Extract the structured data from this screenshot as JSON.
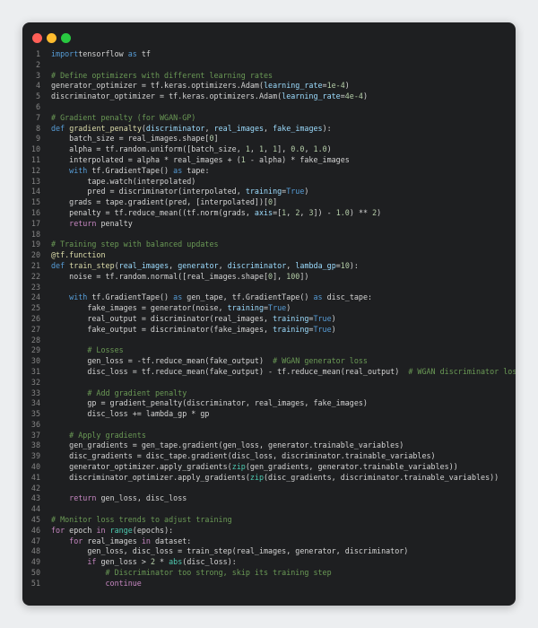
{
  "window": {
    "buttons": [
      "close",
      "minimize",
      "maximize"
    ]
  },
  "code": {
    "lines": [
      {
        "n": "1",
        "segs": [
          [
            "kw",
            "import"
          ],
          [
            "",
            "tensorflow "
          ],
          [
            "kw",
            "as"
          ],
          [
            "",
            " tf"
          ]
        ]
      },
      {
        "n": "2",
        "segs": []
      },
      {
        "n": "3",
        "segs": [
          [
            "cm",
            "# Define optimizers with different learning rates"
          ]
        ]
      },
      {
        "n": "4",
        "segs": [
          [
            "",
            "generator_optimizer = tf.keras.optimizers.Adam("
          ],
          [
            "pa",
            "learning_rate"
          ],
          [
            "",
            "="
          ],
          [
            "nm",
            "1e-4"
          ],
          [
            "",
            ")"
          ]
        ]
      },
      {
        "n": "5",
        "segs": [
          [
            "",
            "discriminator_optimizer = tf.keras.optimizers.Adam("
          ],
          [
            "pa",
            "learning_rate"
          ],
          [
            "",
            "="
          ],
          [
            "nm",
            "4e-4"
          ],
          [
            "",
            ")"
          ]
        ]
      },
      {
        "n": "6",
        "segs": []
      },
      {
        "n": "7",
        "segs": [
          [
            "cm",
            "# Gradient penalty (for WGAN-GP)"
          ]
        ]
      },
      {
        "n": "8",
        "segs": [
          [
            "kw",
            "def"
          ],
          [
            "",
            " "
          ],
          [
            "fn",
            "gradient_penalty"
          ],
          [
            "",
            "("
          ],
          [
            "pa",
            "discriminator"
          ],
          [
            "",
            ", "
          ],
          [
            "pa",
            "real_images"
          ],
          [
            "",
            ", "
          ],
          [
            "pa",
            "fake_images"
          ],
          [
            "",
            "):"
          ]
        ]
      },
      {
        "n": "9",
        "segs": [
          [
            "",
            "    batch_size = real_images.shape["
          ],
          [
            "nm",
            "0"
          ],
          [
            "",
            "]"
          ]
        ]
      },
      {
        "n": "10",
        "segs": [
          [
            "",
            "    alpha = tf.random.uniform([batch_size, "
          ],
          [
            "nm",
            "1"
          ],
          [
            "",
            ", "
          ],
          [
            "nm",
            "1"
          ],
          [
            "",
            ", "
          ],
          [
            "nm",
            "1"
          ],
          [
            "",
            "], "
          ],
          [
            "nm",
            "0.0"
          ],
          [
            "",
            ", "
          ],
          [
            "nm",
            "1.0"
          ],
          [
            "",
            ")"
          ]
        ]
      },
      {
        "n": "11",
        "segs": [
          [
            "",
            "    interpolated = alpha * real_images + ("
          ],
          [
            "nm",
            "1"
          ],
          [
            "",
            " - alpha) * fake_images"
          ]
        ]
      },
      {
        "n": "12",
        "segs": [
          [
            "",
            "    "
          ],
          [
            "kw",
            "with"
          ],
          [
            "",
            " tf.GradientTape() "
          ],
          [
            "kw",
            "as"
          ],
          [
            "",
            " tape:"
          ]
        ]
      },
      {
        "n": "13",
        "segs": [
          [
            "",
            "        tape.watch(interpolated)"
          ]
        ]
      },
      {
        "n": "14",
        "segs": [
          [
            "",
            "        pred = discriminator(interpolated, "
          ],
          [
            "pa",
            "training"
          ],
          [
            "",
            "="
          ],
          [
            "kw",
            "True"
          ],
          [
            "",
            ")"
          ]
        ]
      },
      {
        "n": "15",
        "segs": [
          [
            "",
            "    grads = tape.gradient(pred, [interpolated])["
          ],
          [
            "nm",
            "0"
          ],
          [
            "",
            "]"
          ]
        ]
      },
      {
        "n": "16",
        "segs": [
          [
            "",
            "    penalty = tf.reduce_mean((tf.norm(grads, "
          ],
          [
            "pa",
            "axis"
          ],
          [
            "",
            "=["
          ],
          [
            "nm",
            "1"
          ],
          [
            "",
            ", "
          ],
          [
            "nm",
            "2"
          ],
          [
            "",
            ", "
          ],
          [
            "nm",
            "3"
          ],
          [
            "",
            "]) - "
          ],
          [
            "nm",
            "1.0"
          ],
          [
            "",
            ") ** "
          ],
          [
            "nm",
            "2"
          ],
          [
            "",
            ")"
          ]
        ]
      },
      {
        "n": "17",
        "segs": [
          [
            "",
            "    "
          ],
          [
            "ck",
            "return"
          ],
          [
            "",
            " penalty"
          ]
        ]
      },
      {
        "n": "18",
        "segs": []
      },
      {
        "n": "19",
        "segs": [
          [
            "cm",
            "# Training step with balanced updates"
          ]
        ]
      },
      {
        "n": "20",
        "segs": [
          [
            "dc",
            "@tf.function"
          ]
        ]
      },
      {
        "n": "21",
        "segs": [
          [
            "kw",
            "def"
          ],
          [
            "",
            " "
          ],
          [
            "fn",
            "train_step"
          ],
          [
            "",
            "("
          ],
          [
            "pa",
            "real_images"
          ],
          [
            "",
            ", "
          ],
          [
            "pa",
            "generator"
          ],
          [
            "",
            ", "
          ],
          [
            "pa",
            "discriminator"
          ],
          [
            "",
            ", "
          ],
          [
            "pa",
            "lambda_gp"
          ],
          [
            "",
            "="
          ],
          [
            "nm",
            "10"
          ],
          [
            "",
            "):"
          ]
        ]
      },
      {
        "n": "22",
        "segs": [
          [
            "",
            "    noise = tf.random.normal([real_images.shape["
          ],
          [
            "nm",
            "0"
          ],
          [
            "",
            "], "
          ],
          [
            "nm",
            "100"
          ],
          [
            "",
            "])"
          ]
        ]
      },
      {
        "n": "23",
        "segs": []
      },
      {
        "n": "24",
        "segs": [
          [
            "",
            "    "
          ],
          [
            "kw",
            "with"
          ],
          [
            "",
            " tf.GradientTape() "
          ],
          [
            "kw",
            "as"
          ],
          [
            "",
            " gen_tape, tf.GradientTape() "
          ],
          [
            "kw",
            "as"
          ],
          [
            "",
            " disc_tape:"
          ]
        ]
      },
      {
        "n": "25",
        "segs": [
          [
            "",
            "        fake_images = generator(noise, "
          ],
          [
            "pa",
            "training"
          ],
          [
            "",
            "="
          ],
          [
            "kw",
            "True"
          ],
          [
            "",
            ")"
          ]
        ]
      },
      {
        "n": "26",
        "segs": [
          [
            "",
            "        real_output = discriminator(real_images, "
          ],
          [
            "pa",
            "training"
          ],
          [
            "",
            "="
          ],
          [
            "kw",
            "True"
          ],
          [
            "",
            ")"
          ]
        ]
      },
      {
        "n": "27",
        "segs": [
          [
            "",
            "        fake_output = discriminator(fake_images, "
          ],
          [
            "pa",
            "training"
          ],
          [
            "",
            "="
          ],
          [
            "kw",
            "True"
          ],
          [
            "",
            ")"
          ]
        ]
      },
      {
        "n": "28",
        "segs": []
      },
      {
        "n": "29",
        "segs": [
          [
            "",
            "        "
          ],
          [
            "cm",
            "# Losses"
          ]
        ]
      },
      {
        "n": "30",
        "segs": [
          [
            "",
            "        gen_loss = -tf.reduce_mean(fake_output)  "
          ],
          [
            "cm",
            "# WGAN generator loss"
          ]
        ]
      },
      {
        "n": "31",
        "segs": [
          [
            "",
            "        disc_loss = tf.reduce_mean(fake_output) - tf.reduce_mean(real_output)  "
          ],
          [
            "cm",
            "# WGAN discriminator loss"
          ]
        ]
      },
      {
        "n": "32",
        "segs": []
      },
      {
        "n": "33",
        "segs": [
          [
            "",
            "        "
          ],
          [
            "cm",
            "# Add gradient penalty"
          ]
        ]
      },
      {
        "n": "34",
        "segs": [
          [
            "",
            "        gp = gradient_penalty(discriminator, real_images, fake_images)"
          ]
        ]
      },
      {
        "n": "35",
        "segs": [
          [
            "",
            "        disc_loss += lambda_gp * gp"
          ]
        ]
      },
      {
        "n": "36",
        "segs": []
      },
      {
        "n": "37",
        "segs": [
          [
            "",
            "    "
          ],
          [
            "cm",
            "# Apply gradients"
          ]
        ]
      },
      {
        "n": "38",
        "segs": [
          [
            "",
            "    gen_gradients = gen_tape.gradient(gen_loss, generator.trainable_variables)"
          ]
        ]
      },
      {
        "n": "39",
        "segs": [
          [
            "",
            "    disc_gradients = disc_tape.gradient(disc_loss, discriminator.trainable_variables)"
          ]
        ]
      },
      {
        "n": "40",
        "segs": [
          [
            "",
            "    generator_optimizer.apply_gradients("
          ],
          [
            "bi",
            "zip"
          ],
          [
            "",
            "(gen_gradients, generator.trainable_variables))"
          ]
        ]
      },
      {
        "n": "41",
        "segs": [
          [
            "",
            "    discriminator_optimizer.apply_gradients("
          ],
          [
            "bi",
            "zip"
          ],
          [
            "",
            "(disc_gradients, discriminator.trainable_variables))"
          ]
        ]
      },
      {
        "n": "42",
        "segs": []
      },
      {
        "n": "43",
        "segs": [
          [
            "",
            "    "
          ],
          [
            "ck",
            "return"
          ],
          [
            "",
            " gen_loss, disc_loss"
          ]
        ]
      },
      {
        "n": "44",
        "segs": []
      },
      {
        "n": "45",
        "segs": [
          [
            "cm",
            "# Monitor loss trends to adjust training"
          ]
        ]
      },
      {
        "n": "46",
        "segs": [
          [
            "ck",
            "for"
          ],
          [
            "",
            " epoch "
          ],
          [
            "ck",
            "in"
          ],
          [
            "",
            " "
          ],
          [
            "bi",
            "range"
          ],
          [
            "",
            "(epochs):"
          ]
        ]
      },
      {
        "n": "47",
        "segs": [
          [
            "",
            "    "
          ],
          [
            "ck",
            "for"
          ],
          [
            "",
            " real_images "
          ],
          [
            "ck",
            "in"
          ],
          [
            "",
            " dataset:"
          ]
        ]
      },
      {
        "n": "48",
        "segs": [
          [
            "",
            "        gen_loss, disc_loss = train_step(real_images, generator, discriminator)"
          ]
        ]
      },
      {
        "n": "49",
        "segs": [
          [
            "",
            "        "
          ],
          [
            "ck",
            "if"
          ],
          [
            "",
            " gen_loss > "
          ],
          [
            "nm",
            "2"
          ],
          [
            "",
            " * "
          ],
          [
            "bi",
            "abs"
          ],
          [
            "",
            "(disc_loss):"
          ]
        ]
      },
      {
        "n": "50",
        "segs": [
          [
            "",
            "            "
          ],
          [
            "cm",
            "# Discriminator too strong, skip its training step"
          ]
        ]
      },
      {
        "n": "51",
        "segs": [
          [
            "",
            "            "
          ],
          [
            "ck",
            "continue"
          ]
        ]
      }
    ]
  }
}
